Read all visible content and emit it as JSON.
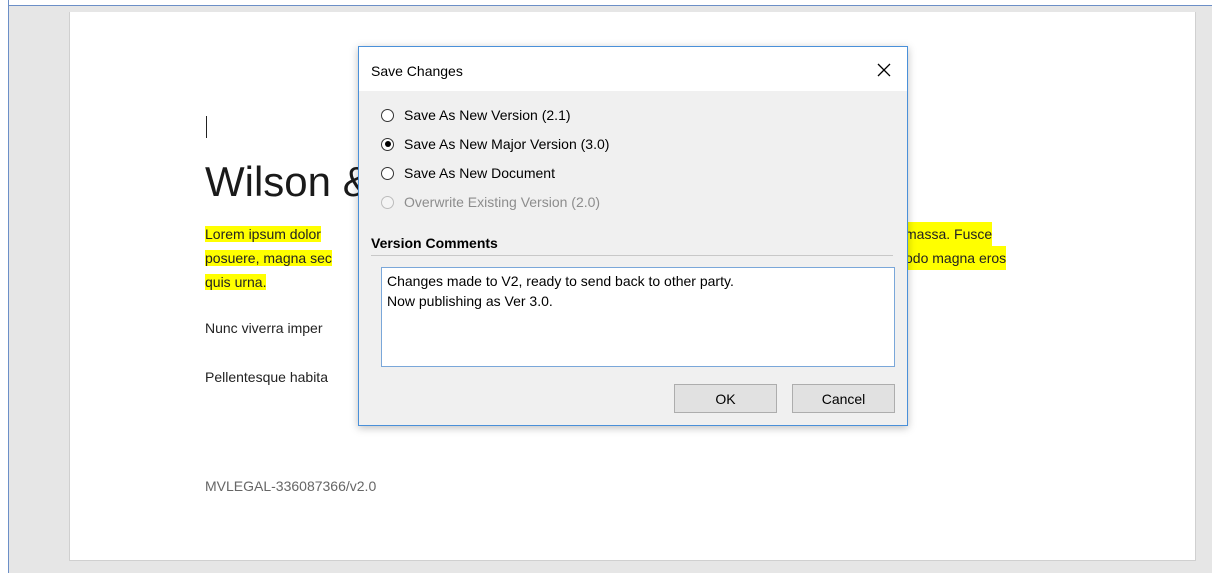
{
  "document": {
    "title_visible": "Wilson &",
    "paragraph_1_left": "Lorem ipsum dolor",
    "paragraph_1_mid": "posuere, magna sec",
    "paragraph_1_end": "quis urna.",
    "paragraph_1_right_1": "massa. Fusce",
    "paragraph_1_right_2": "odo magna eros",
    "paragraph_2_left": "Nunc viverra imper",
    "paragraph_3_left": "Pellentesque habita",
    "footer_id": "MVLEGAL-336087366/v2.0",
    "highlight_color": "#ffff00"
  },
  "dialog": {
    "title": "Save Changes",
    "close_icon": "close-icon",
    "options": [
      {
        "label": "Save As New Version (2.1)",
        "checked": false,
        "enabled": true
      },
      {
        "label": "Save As New Major Version (3.0)",
        "checked": true,
        "enabled": true
      },
      {
        "label": "Save As New Document",
        "checked": false,
        "enabled": true
      },
      {
        "label": "Overwrite Existing Version (2.0)",
        "checked": false,
        "enabled": false
      }
    ],
    "comments_heading": "Version Comments",
    "comments_value": "Changes made to V2, ready to send back to other party.\nNow publishing as Ver 3.0.",
    "ok_label": "OK",
    "cancel_label": "Cancel",
    "accent_color": "#4a90d9"
  }
}
